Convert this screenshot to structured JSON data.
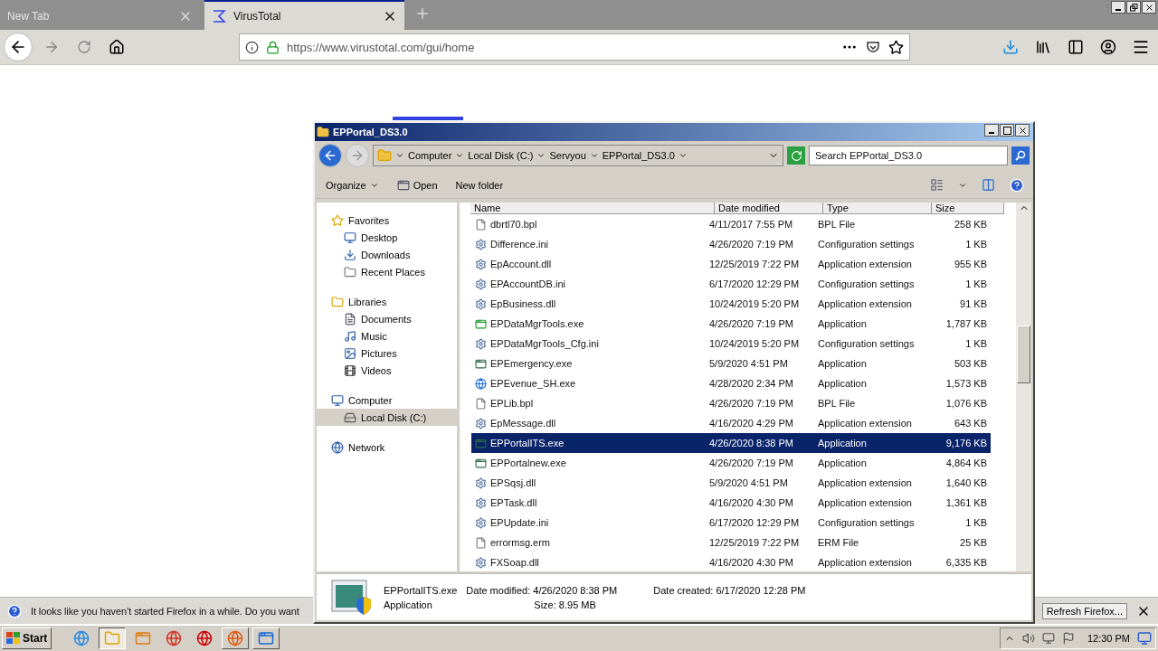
{
  "tabs": [
    {
      "label": "New Tab",
      "selected": false
    },
    {
      "label": "VirusTotal",
      "selected": true
    }
  ],
  "url": "https://www.virustotal.com/gui/home",
  "explorer": {
    "title": "EPPortal_DS3.0",
    "breadcrumbs": [
      "Computer",
      "Local Disk (C:)",
      "Servyou",
      "EPPortal_DS3.0"
    ],
    "search": {
      "placeholder": "Search EPPortal_DS3.0"
    },
    "toolbar": {
      "organize": "Organize",
      "open": "Open",
      "new_folder": "New folder"
    },
    "nav": [
      {
        "kind": "favorites",
        "label": "Favorites",
        "selected": false,
        "children": [
          {
            "kind": "desktop",
            "label": "Desktop",
            "selected": false
          },
          {
            "kind": "downloads",
            "label": "Downloads",
            "selected": false
          },
          {
            "kind": "recent",
            "label": "Recent Places",
            "selected": false
          }
        ]
      },
      {
        "kind": "libraries",
        "label": "Libraries",
        "selected": false,
        "children": [
          {
            "kind": "documents",
            "label": "Documents",
            "selected": false
          },
          {
            "kind": "music",
            "label": "Music",
            "selected": false
          },
          {
            "kind": "pictures",
            "label": "Pictures",
            "selected": false
          },
          {
            "kind": "videos",
            "label": "Videos",
            "selected": false
          }
        ]
      },
      {
        "kind": "computer",
        "label": "Computer",
        "selected": false,
        "children": [
          {
            "kind": "disk",
            "label": "Local Disk (C:)",
            "selected": true
          }
        ]
      },
      {
        "kind": "network",
        "label": "Network",
        "selected": false
      }
    ],
    "columns": [
      "Name",
      "Date modified",
      "Type",
      "Size"
    ],
    "files": [
      {
        "kind": "file",
        "name": "dbrtl70.bpl",
        "date": "4/11/2017 7:55 PM",
        "type": "BPL File",
        "size": "258 KB",
        "selected": false
      },
      {
        "kind": "settings",
        "name": "Difference.ini",
        "date": "4/26/2020 7:19 PM",
        "type": "Configuration settings",
        "size": "1 KB",
        "selected": false
      },
      {
        "kind": "settings",
        "name": "EpAccount.dll",
        "date": "12/25/2019 7:22 PM",
        "type": "Application extension",
        "size": "955 KB",
        "selected": false
      },
      {
        "kind": "settings",
        "name": "EPAccountDB.ini",
        "date": "6/17/2020 12:29 PM",
        "type": "Configuration settings",
        "size": "1 KB",
        "selected": false
      },
      {
        "kind": "settings",
        "name": "EpBusiness.dll",
        "date": "10/24/2019 5:20 PM",
        "type": "Application extension",
        "size": "91 KB",
        "selected": false
      },
      {
        "kind": "green",
        "name": "EPDataMgrTools.exe",
        "date": "4/26/2020 7:19 PM",
        "type": "Application",
        "size": "1,787 KB",
        "selected": false
      },
      {
        "kind": "settings",
        "name": "EPDataMgrTools_Cfg.ini",
        "date": "10/24/2019 5:20 PM",
        "type": "Configuration settings",
        "size": "1 KB",
        "selected": false
      },
      {
        "kind": "app",
        "name": "EPEmergency.exe",
        "date": "5/9/2020 4:51 PM",
        "type": "Application",
        "size": "503 KB",
        "selected": false
      },
      {
        "kind": "blue",
        "name": "EPEvenue_SH.exe",
        "date": "4/28/2020 2:34 PM",
        "type": "Application",
        "size": "1,573 KB",
        "selected": false
      },
      {
        "kind": "file",
        "name": "EPLib.bpl",
        "date": "4/26/2020 7:19 PM",
        "type": "BPL File",
        "size": "1,076 KB",
        "selected": false
      },
      {
        "kind": "settings",
        "name": "EpMessage.dll",
        "date": "4/16/2020 4:29 PM",
        "type": "Application extension",
        "size": "643 KB",
        "selected": false
      },
      {
        "kind": "app",
        "name": "EPPortalITS.exe",
        "date": "4/26/2020 8:38 PM",
        "type": "Application",
        "size": "9,176 KB",
        "selected": true
      },
      {
        "kind": "app",
        "name": "EPPortalnew.exe",
        "date": "4/26/2020 7:19 PM",
        "type": "Application",
        "size": "4,864 KB",
        "selected": false
      },
      {
        "kind": "settings",
        "name": "EPSqsj.dll",
        "date": "5/9/2020 4:51 PM",
        "type": "Application extension",
        "size": "1,640 KB",
        "selected": false
      },
      {
        "kind": "settings",
        "name": "EPTask.dll",
        "date": "4/16/2020 4:30 PM",
        "type": "Application extension",
        "size": "1,361 KB",
        "selected": false
      },
      {
        "kind": "settings",
        "name": "EPUpdate.ini",
        "date": "6/17/2020 12:29 PM",
        "type": "Configuration settings",
        "size": "1 KB",
        "selected": false
      },
      {
        "kind": "file",
        "name": "errormsg.erm",
        "date": "12/25/2019 7:22 PM",
        "type": "ERM File",
        "size": "25 KB",
        "selected": false
      },
      {
        "kind": "settings",
        "name": "FXSoap.dll",
        "date": "4/16/2020 4:30 PM",
        "type": "Application extension",
        "size": "6,335 KB",
        "selected": false
      }
    ],
    "details": {
      "name": "EPPortalITS.exe",
      "type": "Application",
      "fields": [
        {
          "label": "Date modified:",
          "value": "4/26/2020 8:38 PM"
        },
        {
          "label": "Date created:",
          "value": "6/17/2020 12:28 PM"
        },
        {
          "label": "Size:",
          "value": "8.95 MB"
        }
      ]
    }
  },
  "notification": {
    "message": "It looks like you haven’t started Firefox in a while. Do you want",
    "button": "Refresh Firefox..."
  },
  "taskbar": {
    "start": "Start",
    "apps": [
      {
        "kind": "ie",
        "selected": false,
        "open": false
      },
      {
        "kind": "explorer",
        "selected": true,
        "open": true
      },
      {
        "kind": "media",
        "selected": false,
        "open": false
      },
      {
        "kind": "chrome",
        "selected": false,
        "open": false
      },
      {
        "kind": "opera",
        "selected": false,
        "open": false
      },
      {
        "kind": "firefox",
        "selected": false,
        "open": true
      },
      {
        "kind": "blue-app",
        "selected": false,
        "open": true
      }
    ],
    "time": "12:30 PM"
  }
}
